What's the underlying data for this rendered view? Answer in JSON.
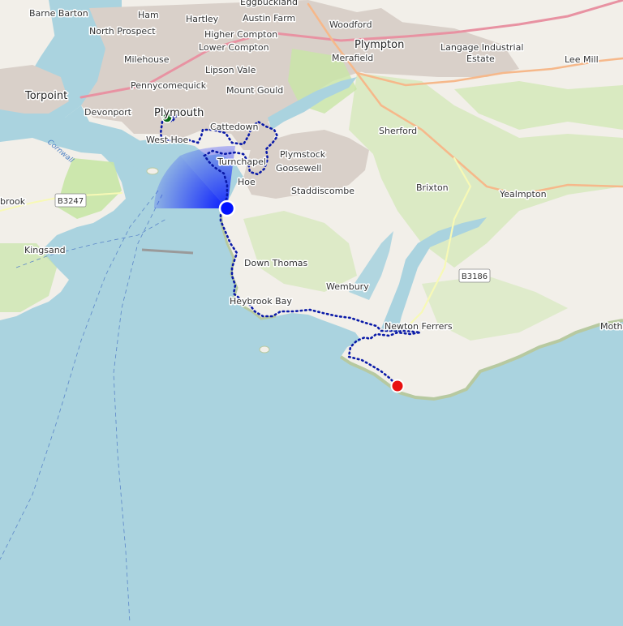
{
  "map": {
    "colors": {
      "sea": "#aad3df",
      "land": "#f2efe9",
      "urban": "#d9d0c9",
      "green": "#c8e6a6",
      "coast_cliff": "#b7c9a0",
      "track": "#0a1aa8",
      "marker_current": "#0012ff",
      "marker_start": "#0b6b17",
      "marker_end": "#e81010",
      "road_primary": "#f6b88a",
      "road_trunk": "#e892a2",
      "road_secondary": "#f7f9b6"
    },
    "place_labels": {
      "barne_barton": "Barne Barton",
      "eggbuckland": "Eggbuckland",
      "ham": "Ham",
      "hartley": "Hartley",
      "austin_farm": "Austin Farm",
      "woodford": "Woodford",
      "north_prospect": "North Prospect",
      "higher_compton": "Higher Compton",
      "plympton": "Plympton",
      "milehouse": "Milehouse",
      "lower_compton": "Lower Compton",
      "merafield": "Merafield",
      "langage": "Langage Industrial",
      "estate": "Estate",
      "lee_mill": "Lee Mill",
      "lipson_vale": "Lipson Vale",
      "pennycomequick": "Pennycomequick",
      "torpoint": "Torpoint",
      "mount_gould": "Mount Gould",
      "devonport": "Devonport",
      "plymouth": "Plymouth",
      "cattedown": "Cattedown",
      "sherford": "Sherford",
      "west_hoe": "West Hoe",
      "plymstock": "Plymstock",
      "turnchapel": "Turnchapel",
      "goosewell": "Goosewell",
      "hoe": "Hoe",
      "staddiscombe": "Staddiscombe",
      "brixton": "Brixton",
      "yealmpton": "Yealmpton",
      "brook": "brook",
      "kingsand": "Kingsand",
      "down_thomas": "Down Thomas",
      "wembury": "Wembury",
      "heybrook_bay": "Heybrook Bay",
      "newton_ferrers": "Newton Ferrers",
      "mothe": "Mothe",
      "cornwall": "Cornwall"
    },
    "road_shields": {
      "b3247": "B3247",
      "b3186": "B3186"
    },
    "markers": {
      "start": "start",
      "current": "current-position",
      "end": "end"
    }
  }
}
